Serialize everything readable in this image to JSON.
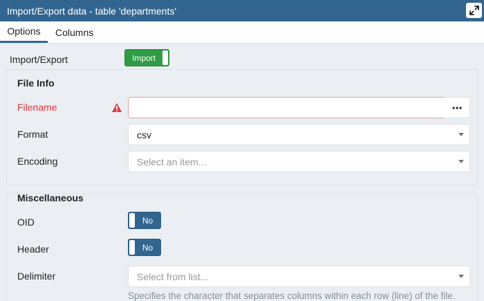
{
  "window": {
    "title": "Import/Export data - table 'departments'",
    "expand_icon": "expand-icon"
  },
  "tabs": [
    {
      "label": "Options",
      "active": true
    },
    {
      "label": "Columns",
      "active": false
    }
  ],
  "import_export": {
    "label": "Import/Export",
    "value": "Import"
  },
  "file_info": {
    "legend": "File Info",
    "filename": {
      "label": "Filename",
      "value": "",
      "error": true,
      "icon": "warning-icon",
      "browse_icon": "more-dots-icon"
    },
    "format": {
      "label": "Format",
      "value": "csv"
    },
    "encoding": {
      "label": "Encoding",
      "placeholder": "Select an item..."
    }
  },
  "miscellaneous": {
    "legend": "Miscellaneous",
    "oid": {
      "label": "OID",
      "value": "No"
    },
    "header": {
      "label": "Header",
      "value": "No"
    },
    "delimiter": {
      "label": "Delimiter",
      "placeholder": "Select from list...",
      "help": "Specifies the character that separates columns within each row (line) of the file."
    }
  },
  "colors": {
    "titlebar": "#326690",
    "import_toggle": "#2f9b45",
    "error": "#e0353b"
  }
}
